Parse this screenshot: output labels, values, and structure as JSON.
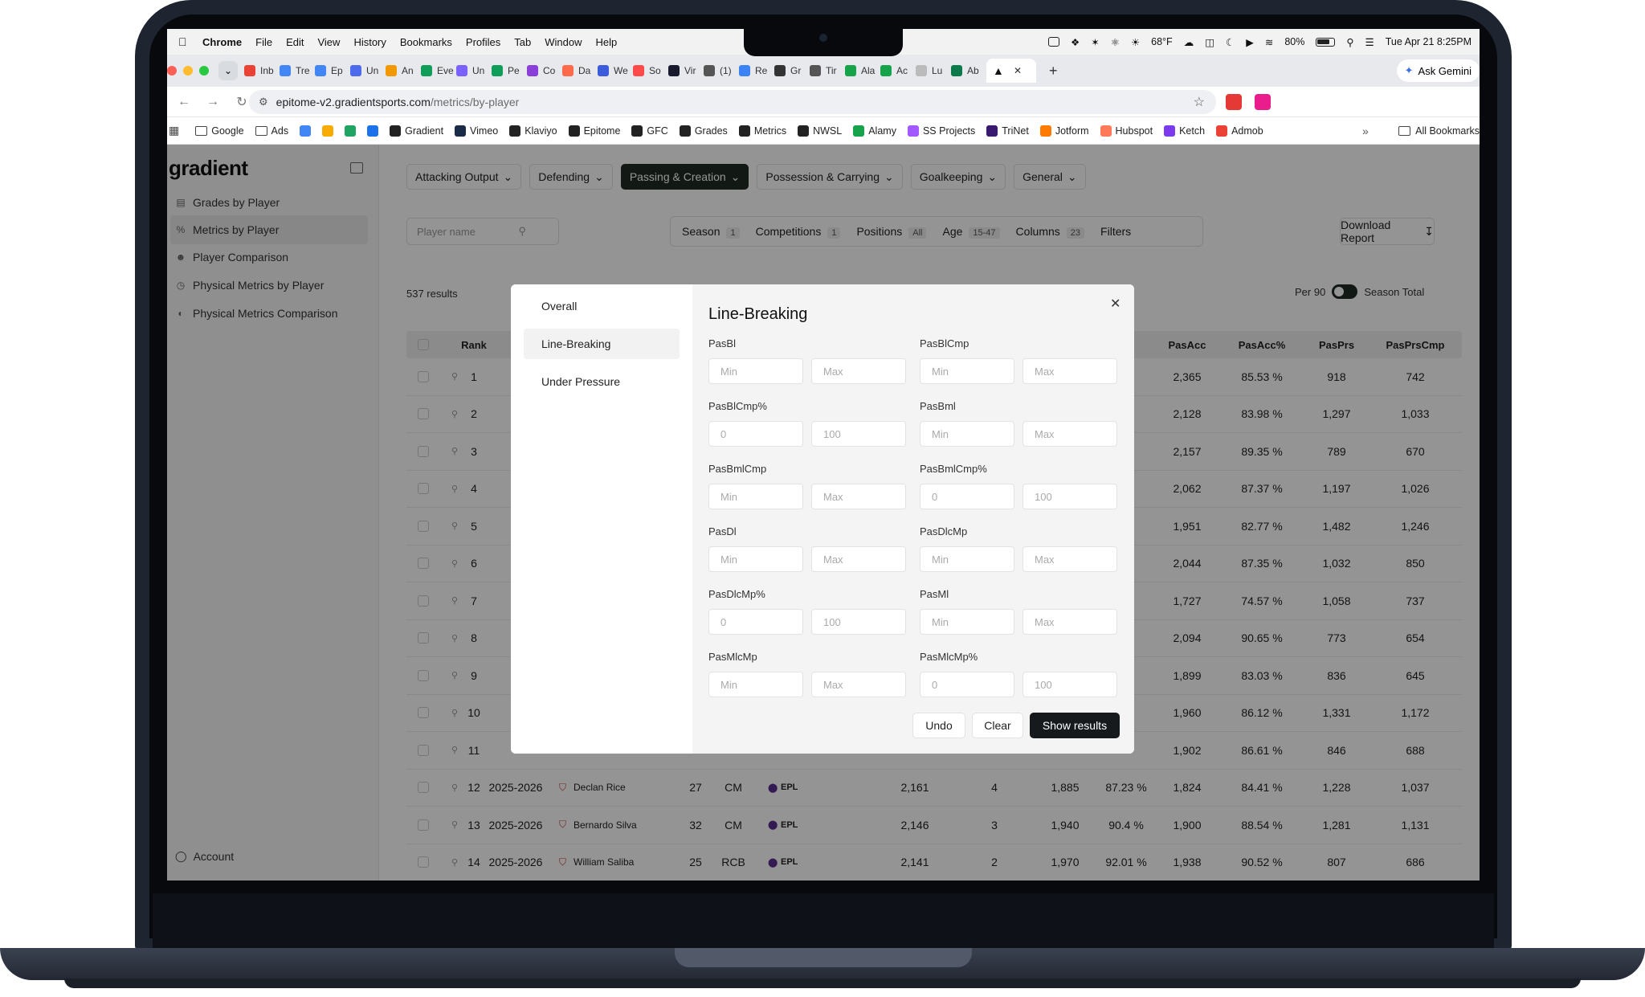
{
  "menubar": {
    "app": "Chrome",
    "menus": [
      "File",
      "Edit",
      "View",
      "History",
      "Bookmarks",
      "Profiles",
      "Tab",
      "Window",
      "Help"
    ],
    "weather": "68°F",
    "battery": "80%",
    "datetime": "Tue Apr 21  8:25PM"
  },
  "tabs": [
    {
      "label": "Inb",
      "color": "#ea4335"
    },
    {
      "label": "Tre",
      "color": "#4285f4"
    },
    {
      "label": "Ep",
      "color": "#4285f4"
    },
    {
      "label": "Un",
      "color": "#4f6bed"
    },
    {
      "label": "An",
      "color": "#f29900"
    },
    {
      "label": "Eve",
      "color": "#0f9d58"
    },
    {
      "label": "Un",
      "color": "#7b61ff"
    },
    {
      "label": "Pe",
      "color": "#0f9d58"
    },
    {
      "label": "Co",
      "color": "#8b3fd9"
    },
    {
      "label": "Da",
      "color": "#ff6b4a"
    },
    {
      "label": "We",
      "color": "#3b5bdb"
    },
    {
      "label": "So",
      "color": "#ff4a4a"
    },
    {
      "label": "Vir",
      "color": "#1a1a2e"
    },
    {
      "label": "(1)",
      "color": "#555555"
    },
    {
      "label": "Re",
      "color": "#3b82f6"
    },
    {
      "label": "Gr",
      "color": "#333333"
    },
    {
      "label": "Tir",
      "color": "#555555"
    },
    {
      "label": "Ala",
      "color": "#16a34a"
    },
    {
      "label": "Ac",
      "color": "#16a34a"
    },
    {
      "label": "Lu",
      "color": "#bbbbbb"
    },
    {
      "label": "Ab",
      "color": "#0b7a4b"
    }
  ],
  "gemini_label": "Ask Gemini",
  "address": {
    "host": "epitome-v2.gradientsports.com",
    "path": "/metrics/by-player"
  },
  "bookmarks": [
    {
      "label": "Google",
      "icon": "folder-icon"
    },
    {
      "label": "Ads",
      "icon": "folder-icon"
    },
    {
      "label": "",
      "icon": "docs-icon",
      "color": "#4285f4"
    },
    {
      "label": "",
      "icon": "analytics-icon",
      "color": "#f9ab00"
    },
    {
      "label": "",
      "icon": "app-icon",
      "color": "#1fa463"
    },
    {
      "label": "",
      "icon": "calendar-icon",
      "color": "#1a73e8"
    },
    {
      "label": "Gradient",
      "icon": "gradient-icon",
      "color": "#222222"
    },
    {
      "label": "Vimeo",
      "icon": "vimeo-icon",
      "color": "#1a2b48"
    },
    {
      "label": "Klaviyo",
      "icon": "klaviyo-icon",
      "color": "#222222"
    },
    {
      "label": "Epitome",
      "icon": "epitome-icon",
      "color": "#222222"
    },
    {
      "label": "GFC",
      "icon": "gfc-icon",
      "color": "#222222"
    },
    {
      "label": "Grades",
      "icon": "grades-icon",
      "color": "#222222"
    },
    {
      "label": "Metrics",
      "icon": "metrics-icon",
      "color": "#222222"
    },
    {
      "label": "NWSL",
      "icon": "nwsl-icon",
      "color": "#222222"
    },
    {
      "label": "Alamy",
      "icon": "alamy-icon",
      "color": "#16a34a"
    },
    {
      "label": "SS Projects",
      "icon": "figma-icon",
      "color": "#a259ff"
    },
    {
      "label": "TriNet",
      "icon": "trinet-icon",
      "color": "#3a1a6e"
    },
    {
      "label": "Jotform",
      "icon": "jotform-icon",
      "color": "#ff7a00"
    },
    {
      "label": "Hubspot",
      "icon": "hubspot-icon",
      "color": "#ff7a59"
    },
    {
      "label": "Ketch",
      "icon": "ketch-icon",
      "color": "#7c3aed"
    },
    {
      "label": "Admob",
      "icon": "admob-icon",
      "color": "#ea4335"
    }
  ],
  "all_bookmarks": "All Bookmarks",
  "sidebar": {
    "logo": "gradient",
    "items": [
      {
        "label": "Grades by Player",
        "icon": "bar-chart-icon"
      },
      {
        "label": "Metrics by Player",
        "icon": "percent-icon"
      },
      {
        "label": "Player Comparison",
        "icon": "users-icon"
      },
      {
        "label": "Physical Metrics by Player",
        "icon": "stopwatch-icon"
      },
      {
        "label": "Physical Metrics Comparison",
        "icon": "compare-icon"
      }
    ],
    "account": "Account"
  },
  "categories": [
    "Attacking Output",
    "Defending",
    "Passing & Creation",
    "Possession & Carrying",
    "Goalkeeping",
    "General"
  ],
  "search_placeholder": "Player name",
  "filters": [
    {
      "label": "Season",
      "badge": "1"
    },
    {
      "label": "Competitions",
      "badge": "1"
    },
    {
      "label": "Positions",
      "badge": "All"
    },
    {
      "label": "Age",
      "badge": "15-47"
    },
    {
      "label": "Columns",
      "badge": "23"
    },
    {
      "label": "Filters",
      "badge": ""
    }
  ],
  "download_label": "Download Report",
  "results_text": "537 results",
  "per90_label": "Per 90",
  "season_total_label": "Season Total",
  "table": {
    "headers": {
      "rank": "Rank",
      "pasacc": "PasAcc",
      "pasaccpct": "PasAcc%",
      "paspr": "PasPrs",
      "pasprcmp": "PasPrsCmp"
    },
    "rows": [
      {
        "rank": "1",
        "pasacc": "2,365",
        "pct": "85.53 %",
        "prs": "918",
        "cmp": "742"
      },
      {
        "rank": "2",
        "pasacc": "2,128",
        "pct": "83.98 %",
        "prs": "1,297",
        "cmp": "1,033"
      },
      {
        "rank": "3",
        "pasacc": "2,157",
        "pct": "89.35 %",
        "prs": "789",
        "cmp": "670"
      },
      {
        "rank": "4",
        "pasacc": "2,062",
        "pct": "87.37 %",
        "prs": "1,197",
        "cmp": "1,026"
      },
      {
        "rank": "5",
        "pasacc": "1,951",
        "pct": "82.77 %",
        "prs": "1,482",
        "cmp": "1,246"
      },
      {
        "rank": "6",
        "pasacc": "2,044",
        "pct": "87.35 %",
        "prs": "1,032",
        "cmp": "850"
      },
      {
        "rank": "7",
        "pasacc": "1,727",
        "pct": "74.57 %",
        "prs": "1,058",
        "cmp": "737"
      },
      {
        "rank": "8",
        "pasacc": "2,094",
        "pct": "90.65 %",
        "prs": "773",
        "cmp": "654"
      },
      {
        "rank": "9",
        "pasacc": "1,899",
        "pct": "83.03 %",
        "prs": "836",
        "cmp": "645"
      },
      {
        "rank": "10",
        "pasacc": "1,960",
        "pct": "86.12 %",
        "prs": "1,331",
        "cmp": "1,172"
      },
      {
        "rank": "11",
        "pasacc": "1,902",
        "pct": "86.61 %",
        "prs": "846",
        "cmp": "688"
      }
    ],
    "full_rows": [
      {
        "rank": "12",
        "season": "2025-2026",
        "player": "Declan Rice",
        "age": "27",
        "pos": "CM",
        "comp": "EPL",
        "c1": "2,161",
        "c2": "4",
        "c3": "1,885",
        "c4": "87.23 %",
        "pasacc": "1,824",
        "pct": "84.41 %",
        "prs": "1,228",
        "cmp": "1,037"
      },
      {
        "rank": "13",
        "season": "2025-2026",
        "player": "Bernardo Silva",
        "age": "32",
        "pos": "CM",
        "comp": "EPL",
        "c1": "2,146",
        "c2": "3",
        "c3": "1,940",
        "c4": "90.4 %",
        "pasacc": "1,900",
        "pct": "88.54 %",
        "prs": "1,281",
        "cmp": "1,131"
      },
      {
        "rank": "14",
        "season": "2025-2026",
        "player": "William Saliba",
        "age": "25",
        "pos": "RCB",
        "comp": "EPL",
        "c1": "2,141",
        "c2": "2",
        "c3": "1,970",
        "c4": "92.01 %",
        "pasacc": "1,938",
        "pct": "90.52 %",
        "prs": "807",
        "cmp": "686"
      }
    ]
  },
  "modal": {
    "sections": [
      "Overall",
      "Line-Breaking",
      "Under Pressure"
    ],
    "title": "Line-Breaking",
    "fields": [
      {
        "label": "PasBl",
        "min": "Min",
        "max": "Max"
      },
      {
        "label": "PasBlCmp",
        "min": "Min",
        "max": "Max"
      },
      {
        "label": "PasBlCmp%",
        "min": "0",
        "max": "100"
      },
      {
        "label": "PasBml",
        "min": "Min",
        "max": "Max"
      },
      {
        "label": "PasBmlCmp",
        "min": "Min",
        "max": "Max"
      },
      {
        "label": "PasBmlCmp%",
        "min": "0",
        "max": "100"
      },
      {
        "label": "PasDl",
        "min": "Min",
        "max": "Max"
      },
      {
        "label": "PasDlcMp",
        "min": "Min",
        "max": "Max"
      },
      {
        "label": "PasDlcMp%",
        "min": "0",
        "max": "100"
      },
      {
        "label": "PasMl",
        "min": "Min",
        "max": "Max"
      },
      {
        "label": "PasMlcMp",
        "min": "Min",
        "max": "Max"
      },
      {
        "label": "PasMlcMp%",
        "min": "0",
        "max": "100"
      }
    ],
    "undo": "Undo",
    "clear": "Clear",
    "show": "Show results"
  }
}
